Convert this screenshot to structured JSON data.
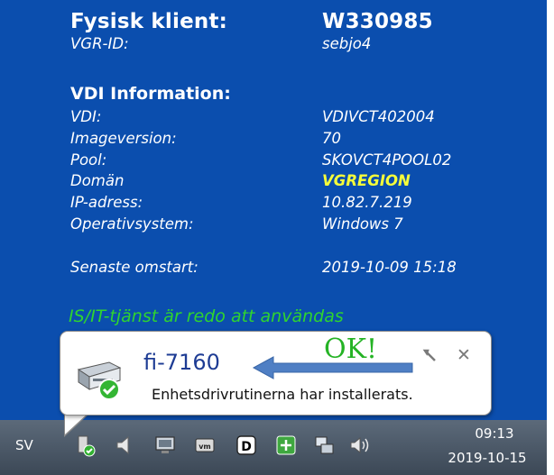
{
  "info": {
    "client_label": "Fysisk klient:",
    "client_value": "W330985",
    "vgr_label": "VGR-ID:",
    "vgr_value": "sebjo4",
    "vdi_title": "VDI Information:",
    "rows": [
      {
        "label": "VDI:",
        "value": "VDIVCT402004"
      },
      {
        "label": "Imageversion:",
        "value": "70"
      },
      {
        "label": "Pool:",
        "value": "SKOVCT4POOL02"
      },
      {
        "label": "Domän",
        "value": "VGREGION"
      },
      {
        "label": "IP-adress:",
        "value": "10.82.7.219"
      },
      {
        "label": "Operativsystem:",
        "value": "Windows 7"
      }
    ],
    "restart_label": "Senaste omstart:",
    "restart_value": "2019-10-09 15:18",
    "status": "IS/IT-tjänst är redo att användas"
  },
  "balloon": {
    "title": "fi-7160",
    "message": "Enhetsdrivrutinerna har installerats.",
    "annotation": "OK!",
    "close_label": "✕"
  },
  "taskbar": {
    "language": "SV",
    "time": "09:13",
    "date": "2019-10-15"
  },
  "colors": {
    "desktop": "#0b4eae",
    "highlight": "#f6ff3a",
    "status_green": "#2fd42f",
    "balloon_title": "#1e3c94",
    "annotation_green": "#25b325",
    "arrow": "#4f7fc4"
  },
  "icons": [
    "scanner-device-icon",
    "blue-arrow",
    "wrench-icon",
    "close-icon",
    "device-install-icon",
    "speaker-icon",
    "network-icon",
    "shield-icon",
    "wifi-icon",
    "vm-icon",
    "id-icon",
    "printer-icon",
    "tool-icon"
  ]
}
